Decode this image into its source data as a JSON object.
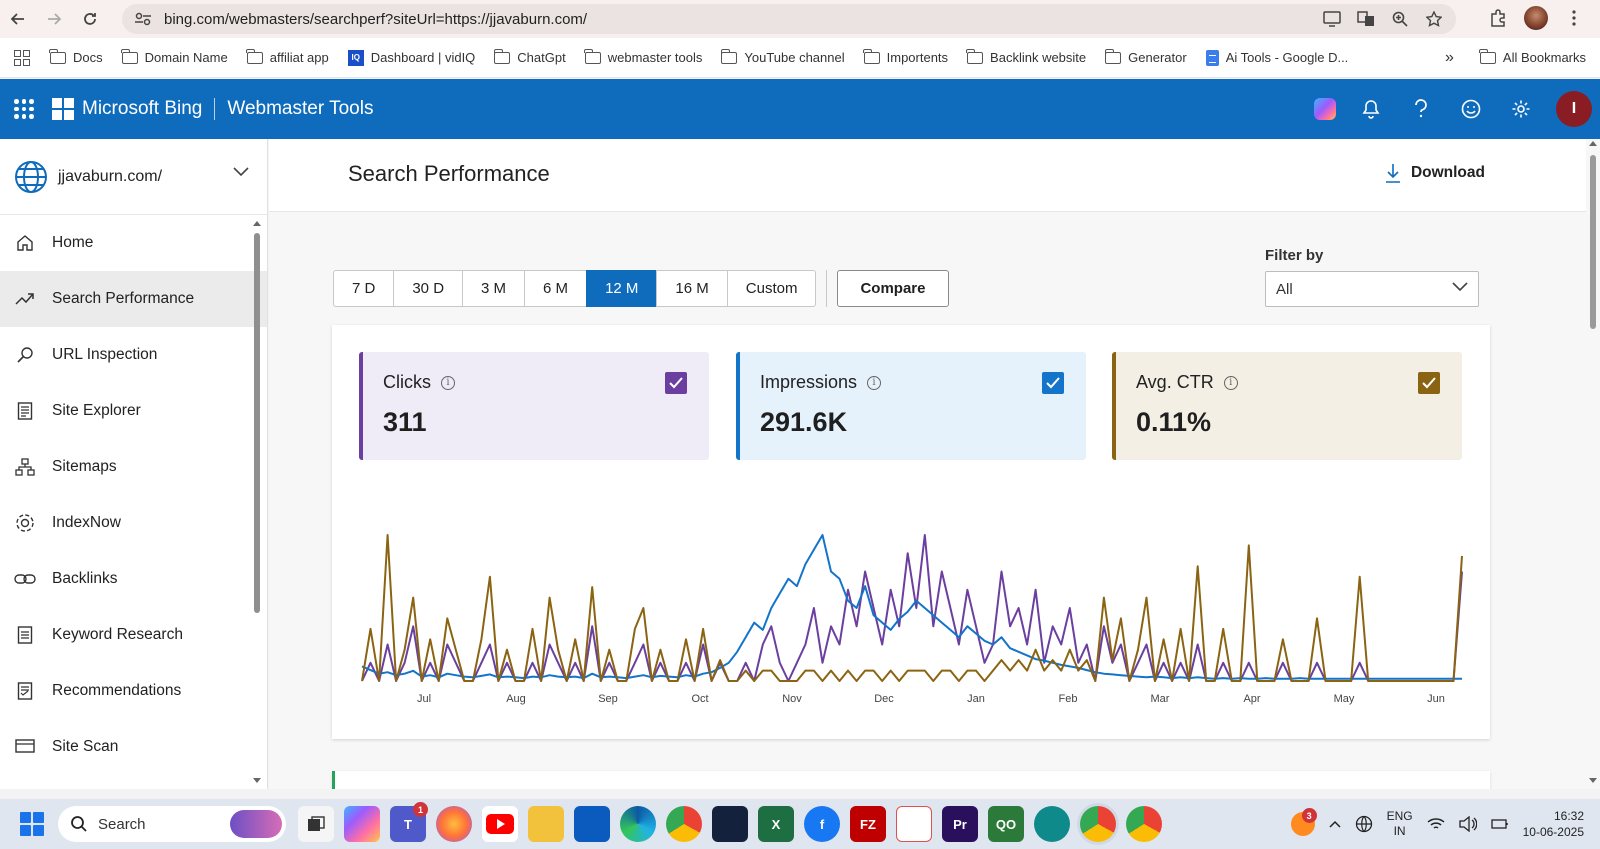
{
  "browser": {
    "url": "bing.com/webmasters/searchperf?siteUrl=https://jjavaburn.com/"
  },
  "bookmarks": {
    "items": [
      {
        "label": "Docs",
        "icon": "folder-icon"
      },
      {
        "label": "Domain Name",
        "icon": "folder-icon"
      },
      {
        "label": "affiliat app",
        "icon": "folder-icon"
      },
      {
        "label": "Dashboard | vidIQ",
        "icon": "vidiq-icon"
      },
      {
        "label": "ChatGpt",
        "icon": "folder-icon"
      },
      {
        "label": "webmaster tools",
        "icon": "folder-icon"
      },
      {
        "label": "YouTube channel",
        "icon": "folder-icon"
      },
      {
        "label": "Importents",
        "icon": "folder-icon"
      },
      {
        "label": "Backlink website",
        "icon": "folder-icon"
      },
      {
        "label": "Generator",
        "icon": "folder-icon"
      },
      {
        "label": "Ai Tools - Google D...",
        "icon": "google-docs-icon"
      }
    ],
    "overflow": "»",
    "all_bookmarks": "All Bookmarks",
    "vidiq_mark": "IQ"
  },
  "header": {
    "brand": "Microsoft Bing",
    "product": "Webmaster Tools",
    "avatar_initial": "I",
    "colors": {
      "bar": "#0f6cbd"
    }
  },
  "sidebar": {
    "site": "jjavaburn.com/",
    "items": [
      {
        "label": "Home",
        "icon": "home-icon"
      },
      {
        "label": "Search Performance",
        "icon": "trend-icon",
        "active": true
      },
      {
        "label": "URL Inspection",
        "icon": "search-icon"
      },
      {
        "label": "Site Explorer",
        "icon": "document-list-icon"
      },
      {
        "label": "Sitemaps",
        "icon": "sitemap-icon"
      },
      {
        "label": "IndexNow",
        "icon": "gear-icon"
      },
      {
        "label": "Backlinks",
        "icon": "link-icon"
      },
      {
        "label": "Keyword Research",
        "icon": "document-icon"
      },
      {
        "label": "Recommendations",
        "icon": "recommendations-icon"
      },
      {
        "label": "Site Scan",
        "icon": "site-scan-icon"
      }
    ]
  },
  "main": {
    "title": "Search Performance",
    "download_label": "Download",
    "ranges": [
      "7 D",
      "30 D",
      "3 M",
      "6 M",
      "12 M",
      "16 M",
      "Custom"
    ],
    "active_range": "12 M",
    "compare_label": "Compare",
    "filter_label": "Filter by",
    "filter_value": "All",
    "metrics": {
      "clicks": {
        "label": "Clicks",
        "value": "311",
        "color": "#6b3fa0"
      },
      "impressions": {
        "label": "Impressions",
        "value": "291.6K",
        "color": "#1374c9"
      },
      "ctr": {
        "label": "Avg. CTR",
        "value": "0.11%",
        "color": "#8a6412"
      }
    }
  },
  "chart_data": {
    "type": "line",
    "x_labels": [
      "Jul",
      "Aug",
      "Sep",
      "Oct",
      "Nov",
      "Dec",
      "Jan",
      "Feb",
      "Mar",
      "Apr",
      "May",
      "Jun"
    ],
    "grid": false,
    "series": [
      {
        "name": "Clicks",
        "color": "#6b3fa0",
        "values": [
          0,
          1,
          0,
          2,
          0,
          1,
          3,
          0,
          1,
          0,
          2,
          1,
          0,
          0,
          1,
          2,
          0,
          1,
          0,
          0,
          1,
          0,
          2,
          1,
          0,
          1,
          0,
          3,
          0,
          1,
          0,
          0,
          1,
          2,
          0,
          1,
          0,
          0,
          1,
          0,
          2,
          0,
          1,
          0,
          0,
          1,
          0,
          2,
          3,
          1,
          0,
          1,
          2,
          4,
          1,
          3,
          2,
          5,
          3,
          6,
          4,
          2,
          5,
          3,
          7,
          4,
          8,
          3,
          6,
          4,
          2,
          5,
          3,
          1,
          2,
          6,
          3,
          4,
          2,
          5,
          1,
          3,
          2,
          4,
          1,
          2,
          0,
          3,
          1,
          2,
          0,
          1,
          2,
          0,
          1,
          0,
          1,
          0,
          2,
          0,
          0,
          1,
          0,
          0,
          1,
          0,
          0,
          0,
          1,
          0,
          0,
          0,
          1,
          0,
          0,
          0,
          0,
          1,
          0,
          0,
          0,
          0,
          0,
          0,
          0,
          0,
          0,
          0,
          0,
          6
        ]
      },
      {
        "name": "Impressions",
        "color": "#1374c9",
        "values": [
          20,
          15,
          10,
          12,
          8,
          10,
          14,
          6,
          8,
          5,
          10,
          8,
          6,
          5,
          7,
          9,
          5,
          6,
          5,
          4,
          6,
          5,
          8,
          6,
          5,
          6,
          4,
          10,
          5,
          6,
          5,
          4,
          6,
          8,
          5,
          7,
          6,
          5,
          8,
          6,
          10,
          12,
          18,
          25,
          40,
          60,
          80,
          70,
          100,
          120,
          140,
          130,
          160,
          180,
          200,
          150,
          140,
          110,
          100,
          130,
          90,
          80,
          70,
          85,
          95,
          110,
          100,
          90,
          80,
          70,
          60,
          75,
          65,
          55,
          50,
          60,
          45,
          40,
          35,
          30,
          28,
          25,
          22,
          20,
          18,
          15,
          12,
          10,
          9,
          8,
          7,
          6,
          5,
          6,
          5,
          4,
          5,
          4,
          5,
          4,
          3,
          4,
          3,
          4,
          3,
          3,
          4,
          3,
          3,
          3,
          4,
          3,
          3,
          3,
          3,
          3,
          3,
          3,
          3,
          3,
          3,
          3,
          3,
          3,
          3,
          3,
          3,
          3,
          3,
          3
        ]
      },
      {
        "name": "Avg. CTR",
        "color": "#8a6412",
        "values": [
          0,
          0.5,
          0,
          1.4,
          0,
          0.3,
          0.8,
          0,
          0.4,
          0,
          0.6,
          0.3,
          0,
          0,
          0.4,
          1,
          0,
          0.3,
          0,
          0,
          0.5,
          0,
          0.8,
          0.3,
          0,
          0.4,
          0,
          0.9,
          0,
          0.3,
          0,
          0,
          0.5,
          0.7,
          0,
          0.3,
          0,
          0,
          0.4,
          0,
          0.5,
          0,
          0.2,
          0,
          0,
          0.1,
          0,
          0.1,
          0.1,
          0,
          0,
          0,
          0.1,
          0.1,
          0,
          0.1,
          0,
          0.1,
          0,
          0.1,
          0.1,
          0,
          0.1,
          0,
          0.1,
          0.1,
          0.1,
          0,
          0.1,
          0.1,
          0,
          0.1,
          0.1,
          0,
          0.1,
          0.2,
          0.1,
          0.2,
          0.1,
          0.3,
          0.1,
          0.2,
          0.1,
          0.3,
          0.1,
          0.2,
          0,
          0.8,
          0.2,
          0.6,
          0,
          0.3,
          0.8,
          0,
          0.4,
          0,
          0.5,
          0,
          1.1,
          0,
          0,
          0.5,
          0,
          0,
          1.3,
          0,
          0,
          0,
          0.4,
          0,
          0,
          0,
          0.6,
          0,
          0,
          0,
          0,
          1,
          0,
          0,
          0,
          0,
          0,
          0,
          0,
          0,
          0,
          0,
          0,
          1.2
        ]
      }
    ]
  },
  "taskbar": {
    "search_label": "Search",
    "teams_badge": "1",
    "tray_badge": "3",
    "lang_line1": "ENG",
    "lang_line2": "IN",
    "time": "16:32",
    "date": "10-06-2025",
    "app_glyphs": {
      "teams": "T",
      "filezilla": "FZ",
      "premiere": "Pr",
      "vidiq": "QO",
      "facebook": "f",
      "excel": "X"
    }
  }
}
